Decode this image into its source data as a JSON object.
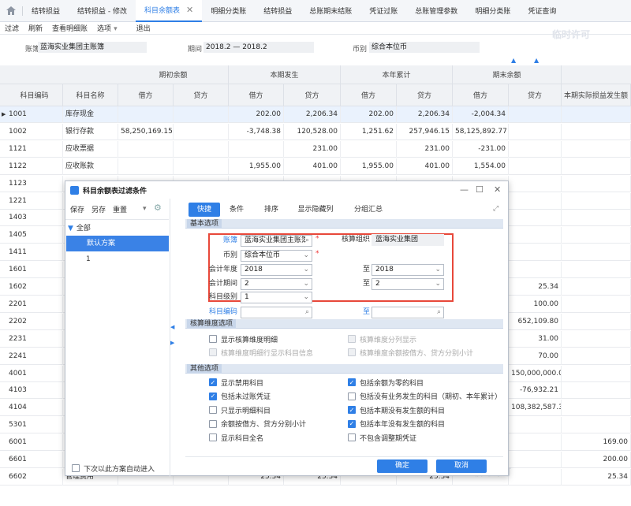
{
  "tabs": [
    {
      "label": "结转损益",
      "active": false
    },
    {
      "label": "结转损益 - 修改",
      "active": false
    },
    {
      "label": "科目余额表",
      "active": true
    },
    {
      "label": "明细分类账",
      "active": false
    },
    {
      "label": "结转损益",
      "active": false
    },
    {
      "label": "总账期末结账",
      "active": false
    },
    {
      "label": "凭证过账",
      "active": false
    },
    {
      "label": "总账管理参数",
      "active": false
    },
    {
      "label": "明细分类账",
      "active": false
    },
    {
      "label": "凭证查询",
      "active": false
    }
  ],
  "toolbar": {
    "filter": "过滤",
    "refresh": "刷新",
    "view_detail": "查看明细账",
    "options": "选项",
    "exit": "退出"
  },
  "filter": {
    "book_label": "账簿",
    "book_value": "蓝海实业集团主账簿",
    "period_label": "期间",
    "period_value": "2018.2 — 2018.2",
    "currency_label": "币别",
    "currency_value": "综合本位币"
  },
  "watermark": "临时许可",
  "grid": {
    "groups": [
      "期初余额",
      "本期发生",
      "本年累计",
      "期末余额"
    ],
    "columns": [
      "科目编码",
      "科目名称",
      "借方",
      "贷方",
      "借方",
      "贷方",
      "借方",
      "贷方",
      "借方",
      "贷方",
      "本期实际损益发生额"
    ],
    "rows": [
      [
        "1001",
        "库存现金",
        "",
        "",
        "202.00",
        "2,206.34",
        "202.00",
        "2,206.34",
        "-2,004.34",
        "",
        ""
      ],
      [
        "1002",
        "银行存款",
        "58,250,169.15",
        "",
        "-3,748.38",
        "120,528.00",
        "1,251.62",
        "257,946.15",
        "58,125,892.77",
        "",
        ""
      ],
      [
        "1121",
        "应收票据",
        "",
        "",
        "",
        "231.00",
        "",
        "231.00",
        "-231.00",
        "",
        ""
      ],
      [
        "1122",
        "应收账款",
        "",
        "",
        "1,955.00",
        "401.00",
        "1,955.00",
        "401.00",
        "1,554.00",
        "",
        ""
      ],
      [
        "1123",
        "",
        "",
        "",
        "",
        "",
        "",
        "",
        "",
        "",
        ""
      ],
      [
        "1221",
        "",
        "",
        "",
        "",
        "",
        "",
        "",
        "",
        "",
        ""
      ],
      [
        "1403",
        "",
        "",
        "",
        "",
        "",
        "",
        "",
        "",
        "",
        ""
      ],
      [
        "1405",
        "",
        "",
        "",
        "",
        "",
        "",
        "",
        "",
        "",
        ""
      ],
      [
        "1411",
        "",
        "",
        "",
        "",
        "",
        "",
        "",
        "",
        "",
        ""
      ],
      [
        "1601",
        "",
        "",
        "",
        "",
        "",
        "",
        "",
        "",
        "",
        ""
      ],
      [
        "1602",
        "",
        "",
        "",
        "",
        "",
        "",
        "",
        "",
        "25.34",
        ""
      ],
      [
        "2201",
        "",
        "",
        "",
        "",
        "",
        "",
        "",
        "",
        "100.00",
        ""
      ],
      [
        "2202",
        "",
        "",
        "",
        "",
        "",
        "",
        "",
        "",
        "652,109.80",
        ""
      ],
      [
        "2231",
        "",
        "",
        "",
        "",
        "",
        "",
        "",
        "",
        "31.00",
        ""
      ],
      [
        "2241",
        "",
        "",
        "",
        "",
        "",
        "",
        "",
        "",
        "70.00",
        ""
      ],
      [
        "4001",
        "",
        "",
        "",
        "",
        "",
        "",
        "",
        "",
        "150,000,000.00",
        ""
      ],
      [
        "4103",
        "",
        "",
        "",
        "",
        "",
        "",
        "",
        "",
        "-76,932.21",
        ""
      ],
      [
        "4104",
        "",
        "",
        "",
        "",
        "",
        "",
        "",
        "",
        "108,382,587.30",
        ""
      ],
      [
        "5301",
        "",
        "",
        "",
        "",
        "",
        "",
        "",
        "",
        "",
        ""
      ],
      [
        "6001",
        "",
        "",
        "",
        "",
        "",
        "",
        "",
        "",
        "",
        "169.00"
      ],
      [
        "6601",
        "销售费用",
        "200.00",
        "",
        "200.00",
        "200.00",
        "",
        "200.00",
        "",
        "",
        "200.00"
      ],
      [
        "6602",
        "管理费用",
        "",
        "",
        "25.34",
        "25.34",
        "",
        "25.34",
        "",
        "",
        "25.34"
      ]
    ]
  },
  "dialog": {
    "title": "科目余额表过滤条件",
    "left": {
      "save": "保存",
      "save_as": "另存",
      "reset": "重置",
      "tree_root": "全部",
      "tree_items": [
        "默认方案",
        "1"
      ],
      "auto_enter": "下次以此方案自动进入"
    },
    "tabs": [
      "快捷",
      "条件",
      "排序",
      "显示隐藏列",
      "分组汇总"
    ],
    "sections": {
      "basic": "基本选项",
      "dims": "核算维度选项",
      "other": "其他选项"
    },
    "form": {
      "book_label": "账簿",
      "book_value": "蓝海实业集团主账簿",
      "org_label": "核算组织",
      "org_value": "蓝海实业集团",
      "currency_label": "币别",
      "currency_value": "综合本位币",
      "year_label": "会计年度",
      "year_from": "2018",
      "to_label": "至",
      "year_to": "2018",
      "period_label": "会计期间",
      "period_from": "2",
      "period_to": "2",
      "level_label": "科目级别",
      "level_value": "1",
      "code_label": "科目编码"
    },
    "dim_options": [
      {
        "label": "显示核算维度明细",
        "checked": false,
        "disabled": false
      },
      {
        "label": "核算维度分列显示",
        "checked": false,
        "disabled": true
      },
      {
        "label": "核算维度明细行显示科目信息",
        "checked": false,
        "disabled": true
      },
      {
        "label": "核算维度余额按借方、贷方分别小计",
        "checked": false,
        "disabled": true
      }
    ],
    "other_options": [
      {
        "label": "显示禁用科目",
        "checked": true
      },
      {
        "label": "包括余额为零的科目",
        "checked": true
      },
      {
        "label": "包括未过账凭证",
        "checked": true
      },
      {
        "label": "包括没有业务发生的科目（期初、本年累计）",
        "checked": false
      },
      {
        "label": "只显示明细科目",
        "checked": false
      },
      {
        "label": "包括本期没有发生额的科目",
        "checked": true
      },
      {
        "label": "余额按借方、贷方分别小计",
        "checked": false
      },
      {
        "label": "包括本年没有发生额的科目",
        "checked": true
      },
      {
        "label": "显示科目全名",
        "checked": false
      },
      {
        "label": "不包含调整期凭证",
        "checked": false
      }
    ],
    "ok": "确定",
    "cancel": "取消"
  }
}
